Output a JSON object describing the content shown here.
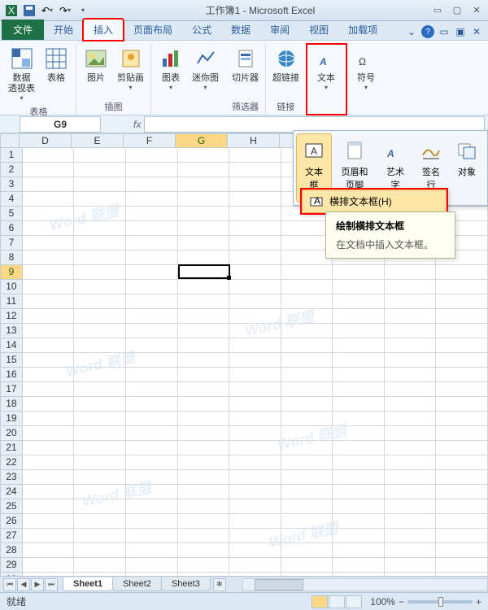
{
  "title": "工作簿1 - Microsoft Excel",
  "tabs": {
    "file": "文件",
    "home": "开始",
    "insert": "插入",
    "layout": "页面布局",
    "formulas": "公式",
    "data": "数据",
    "review": "审阅",
    "view": "视图",
    "addins": "加载项"
  },
  "ribbon": {
    "tables": {
      "label": "表格",
      "pivot": "数据\n透视表",
      "table": "表格"
    },
    "illus": {
      "label": "插图",
      "pic": "图片",
      "clip": "剪贴画"
    },
    "charts": {
      "label": "",
      "chart": "图表",
      "spark": "迷你图"
    },
    "filter": {
      "label": "筛选器",
      "slicer": "切片器"
    },
    "links": {
      "label": "链接",
      "hyper": "超链接"
    },
    "text": {
      "label": "",
      "text": "文本"
    },
    "symbols": {
      "label": "",
      "symbol": "符号"
    }
  },
  "namebox": "G9",
  "fx": "fx",
  "columns": [
    "D",
    "E",
    "F",
    "G",
    "H"
  ],
  "selected_col": "G",
  "selected_row": 9,
  "row_count": 30,
  "gallery": {
    "textbox": "文本框",
    "header": "页眉和页脚",
    "wordart": "艺术字",
    "sigline": "签名行",
    "object": "对象"
  },
  "submenu": {
    "htext": "横排文本框(H)"
  },
  "tooltip": {
    "title": "绘制横排文本框",
    "body": "在文档中插入文本框。"
  },
  "sheets": [
    "Sheet1",
    "Sheet2",
    "Sheet3"
  ],
  "active_sheet": 0,
  "status": "就绪",
  "zoom": "100%",
  "watermark": "Word 联盟"
}
